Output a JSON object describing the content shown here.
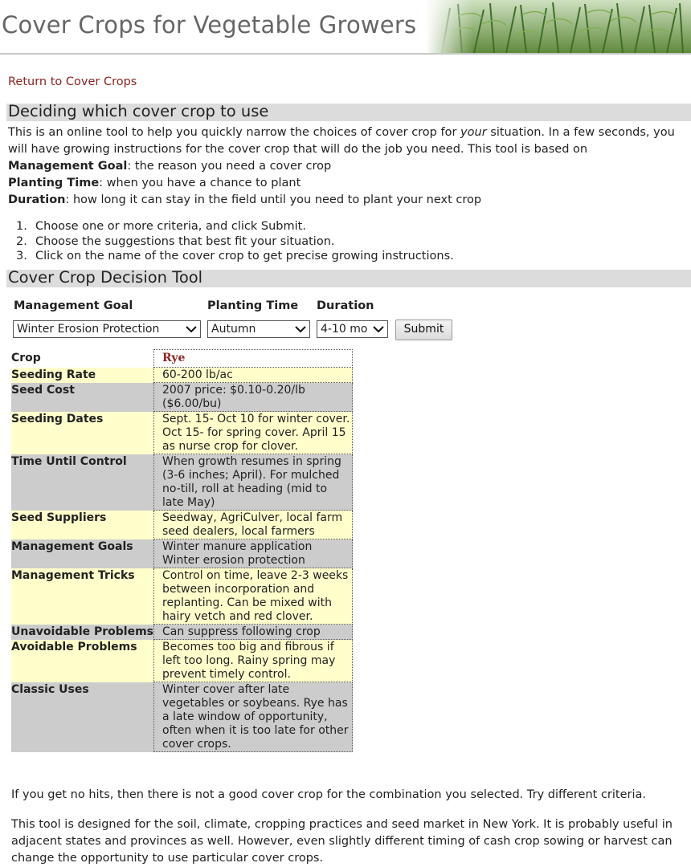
{
  "banner": {
    "title": "Cover Crops for Vegetable Growers"
  },
  "nav": {
    "return_link": "Return to Cover Crops"
  },
  "section1": {
    "heading": "Deciding which cover crop to use",
    "intro_part1": "This is an online tool to help you quickly narrow the choices of cover crop for ",
    "intro_italic": "your",
    "intro_part2": " situation. In a few seconds, you will have growing instructions for the cover crop that will do the job you need. This tool is based on",
    "criteria": [
      {
        "term": "Management Goal",
        "desc": ": the reason you need a cover crop"
      },
      {
        "term": "Planting Time",
        "desc": ": when you have a chance to plant"
      },
      {
        "term": "Duration",
        "desc": ": how long it can stay in the field until you need to plant your next crop"
      }
    ],
    "steps": [
      {
        "num": "1.",
        "text": "Choose one or more criteria, and click Submit."
      },
      {
        "num": "2.",
        "text": "Choose the suggestions that best fit your situation."
      },
      {
        "num": "3.",
        "text": "Click on the name of the cover crop to get precise growing instructions."
      }
    ]
  },
  "section2": {
    "heading": "Cover Crop Decision Tool"
  },
  "form": {
    "goal_label": "Management Goal",
    "goal_value": "Winter Erosion Protection",
    "time_label": "Planting Time",
    "time_value": "Autumn",
    "duration_label": "Duration",
    "duration_value": "4-10 mo",
    "submit_label": "Submit"
  },
  "result": {
    "header_label": "Crop",
    "crop_name": "Rye",
    "rows": [
      {
        "label": "Seeding Rate",
        "value": "60-200 lb/ac"
      },
      {
        "label": "Seed Cost",
        "value": "2007 price: $0.10-0.20/lb ($6.00/bu)"
      },
      {
        "label": "Seeding Dates",
        "value": "Sept. 15- Oct 10 for winter cover. Oct 15- for spring cover. April 15 as nurse crop for clover."
      },
      {
        "label": "Time Until Control",
        "value": "When growth resumes in spring (3-6 inches; April). For mulched no-till, roll at heading (mid to late May)"
      },
      {
        "label": "Seed Suppliers",
        "value": "Seedway, AgriCulver, local farm seed dealers, local farmers"
      },
      {
        "label": "Management Goals",
        "value": "Winter manure application Winter erosion protection"
      },
      {
        "label": "Management Tricks",
        "value": "Control on time, leave 2-3 weeks between incorporation and replanting. Can be mixed with hairy vetch and red clover."
      },
      {
        "label": "Unavoidable Problems",
        "value": "Can suppress following crop"
      },
      {
        "label": "Avoidable Problems",
        "value": "Becomes too big and fibrous if left too long. Rainy spring may prevent timely control."
      },
      {
        "label": "Classic Uses",
        "value": "Winter cover after late vegetables or soybeans. Rye has a late window of opportunity, often when it is too late for other cover crops."
      }
    ]
  },
  "footer": {
    "no_hits": "If you get no hits, then there is not a good cover crop for the combination you selected. Try different criteria.",
    "note": "This tool is designed for the soil, climate, cropping practices and seed market in New York. It is probably useful in adjacent states and provinces as well. However, even slightly different timing of cash crop sowing or harvest can change the opportunity to use particular cover crops."
  }
}
